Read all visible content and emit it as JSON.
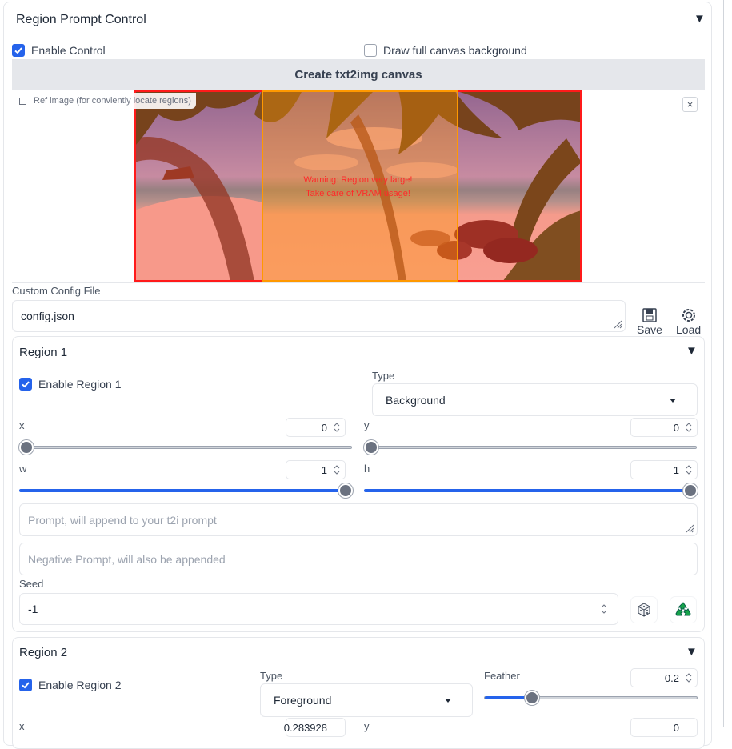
{
  "panel": {
    "title": "Region Prompt Control"
  },
  "controls": {
    "enable_label": "Enable Control",
    "draw_bg_label": "Draw full canvas background",
    "create_button": "Create txt2img canvas"
  },
  "ref": {
    "label": "Ref image (for conviently locate regions)",
    "close": "×"
  },
  "canvas": {
    "warning_line1": "Warning: Region very large!",
    "warning_line2": "Take care of VRAM usage!",
    "colors": {
      "region1": "#ff1a1a",
      "region2": "#ff9900"
    }
  },
  "config": {
    "label": "Custom Config File",
    "value": "config.json",
    "save": "Save",
    "load": "Load"
  },
  "region1": {
    "title": "Region 1",
    "enable_label": "Enable Region 1",
    "type_label": "Type",
    "type_value": "Background",
    "x_label": "x",
    "x_value": "0",
    "x_fraction": 0,
    "y_label": "y",
    "y_value": "0",
    "y_fraction": 0,
    "w_label": "w",
    "w_value": "1",
    "w_fraction": 1,
    "h_label": "h",
    "h_value": "1",
    "h_fraction": 1,
    "prompt_placeholder": "Prompt, will append to your t2i prompt",
    "negative_placeholder": "Negative Prompt, will also be appended",
    "seed_label": "Seed",
    "seed_value": "-1"
  },
  "region2": {
    "title": "Region 2",
    "enable_label": "Enable Region 2",
    "type_label": "Type",
    "type_value": "Foreground",
    "feather_label": "Feather",
    "feather_value": "0.2",
    "feather_fraction": 0.2,
    "x_label": "x",
    "x_value": "0.283928",
    "y_label": "y",
    "y_value": "0"
  },
  "icons": {
    "dice": "dice-icon",
    "recycle": "recycle-icon",
    "save": "floppy-disk-icon",
    "load": "gear-icon"
  }
}
